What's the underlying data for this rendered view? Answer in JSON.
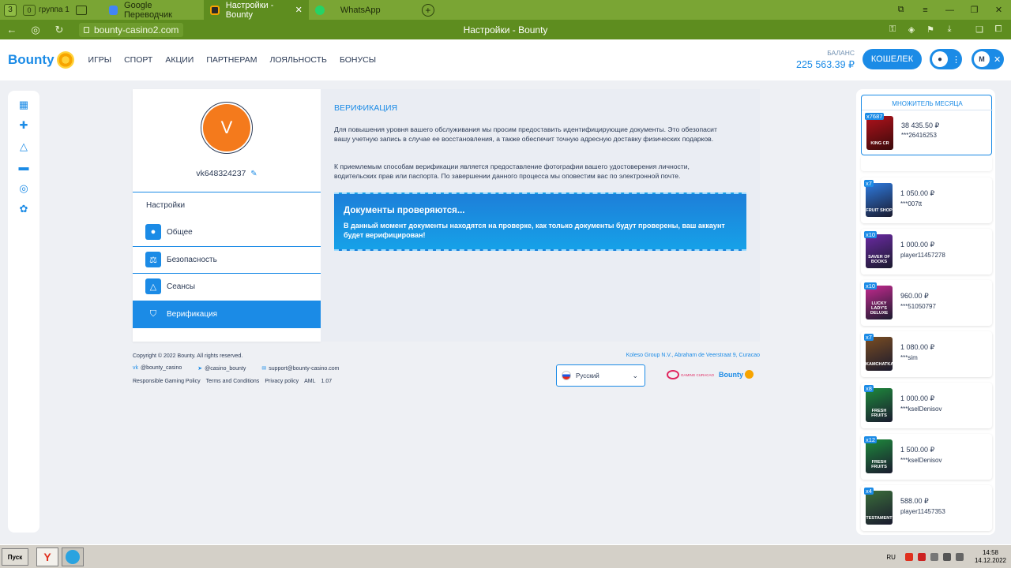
{
  "browser": {
    "tab_count": "3",
    "group_label": "группа 1",
    "group_count": "0",
    "tabs": [
      {
        "label": "Google Переводчик"
      },
      {
        "label": "Настройки - Bounty"
      },
      {
        "label": "WhatsApp"
      }
    ],
    "url": "bounty-casino2.com",
    "page_title": "Настройки - Bounty"
  },
  "header": {
    "logo": "Bounty",
    "nav": [
      "ИГРЫ",
      "СПОРТ",
      "АКЦИИ",
      "ПАРТНЕРАМ",
      "ЛОЯЛЬНОСТЬ",
      "БОНУСЫ"
    ],
    "balance_label": "БАЛАНС",
    "balance_value": "225 563.39 ₽",
    "wallet_label": "КОШЕЛЕК",
    "lang_short": "M"
  },
  "profile": {
    "avatar_letter": "V",
    "username": "vk648324237",
    "settings_heading": "Настройки",
    "menu": [
      {
        "label": "Общее"
      },
      {
        "label": "Безопасность"
      },
      {
        "label": "Сеансы"
      },
      {
        "label": "Верификация"
      }
    ]
  },
  "verification": {
    "title": "ВЕРИФИКАЦИЯ",
    "para1": "Для повышения уровня вашего обслуживания мы просим предоставить идентифицирующие документы. Это обезопасит вашу учетную запись в случае ее восстановления, а также обеспечит точную адресную доставку физических подарков.",
    "para2": "К приемлемым способам верификации является предоставление фотографии вашего удостоверения личности, водительских прав или паспорта. По завершении данного процесса мы оповестим вас по электронной почте.",
    "banner_title": "Документы проверяются...",
    "banner_text": "В данный момент документы находятся на проверке, как только документы будут проверены, ваш аккаунт будет верифицирован!"
  },
  "footer": {
    "copyright": "Copyright © 2022 Bounty. All rights reserved.",
    "vk": "@bounty_casino",
    "telegram": "@casino_bounty",
    "email": "support@bounty-casino.com",
    "links": [
      "Responsible Gaming Policy",
      "Terms and Conditions",
      "Privacy policy",
      "AML",
      "1.07"
    ],
    "company": "Koleso Group N.V., Abraham de Veerstraat 9, Curacao",
    "language": "Русский",
    "gg_label": "GAMING CURACAO",
    "footer_logo": "Bounty"
  },
  "sidebar": {
    "month_title": "МНОЖИТЕЛЬ МЕСЯЦА",
    "month": {
      "mult": "x7687",
      "game": "KING CR",
      "amount": "38 435.50 ₽",
      "player": "***26416253",
      "color": "#b0121c"
    },
    "wins": [
      {
        "mult": "x7",
        "game": "FRUIT SHOP",
        "amount": "1 050.00 ₽",
        "player": "***007tt",
        "color": "#2e7be0"
      },
      {
        "mult": "x10",
        "game": "SAVER OF BOOKS",
        "amount": "1 000.00 ₽",
        "player": "player11457278",
        "color": "#6b2aa3"
      },
      {
        "mult": "x10",
        "game": "LUCKY LADY'S DELUXE",
        "amount": "960.00 ₽",
        "player": "***51050797",
        "color": "#c42a8f"
      },
      {
        "mult": "x7",
        "game": "KAMCHATKA",
        "amount": "1 080.00 ₽",
        "player": "***sim",
        "color": "#7a4d22"
      },
      {
        "mult": "x8",
        "game": "FRESH FRUITS",
        "amount": "1 000.00 ₽",
        "player": "***kselDenisov",
        "color": "#1e8a3c"
      },
      {
        "mult": "x12",
        "game": "FRESH FRUITS",
        "amount": "1 500.00 ₽",
        "player": "***kselDenisov",
        "color": "#1e8a3c"
      },
      {
        "mult": "x4",
        "game": "TESTAMENT",
        "amount": "588.00 ₽",
        "player": "player11457353",
        "color": "#3a6e3a"
      }
    ]
  },
  "taskbar": {
    "start": "Пуск",
    "lang": "RU",
    "time": "14:58",
    "date": "14.12.2022"
  },
  "colors": {
    "accent": "#1b8be6",
    "browser": "#7aa534",
    "avatar": "#f47a1c"
  }
}
